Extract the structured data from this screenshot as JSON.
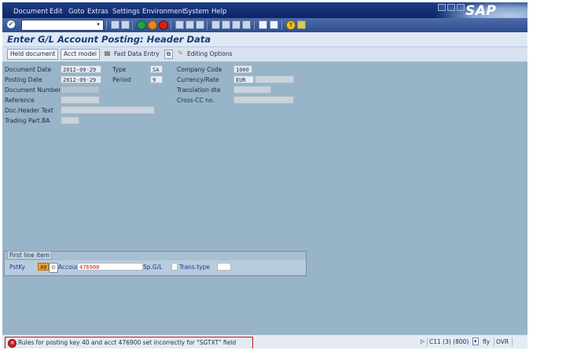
{
  "menubar": {
    "items": [
      "Document",
      "Edit",
      "Goto",
      "Extras",
      "Settings",
      "Environment",
      "System",
      "Help"
    ],
    "underline": [
      "D",
      "E",
      "G",
      "x",
      "S",
      "n",
      "y",
      "H"
    ],
    "logo": "SAP"
  },
  "systoolbar": {
    "command_value": "",
    "icons": [
      "enter-icon",
      "back-icon",
      "exit-icon",
      "cancel-icon",
      "print-icon",
      "find-icon",
      "find-next-icon",
      "first-page-icon",
      "prev-page-icon",
      "next-page-icon",
      "last-page-icon",
      "new-session-icon",
      "shortcut-icon",
      "help-icon",
      "customize-layout-icon"
    ]
  },
  "title": "Enter G/L Account Posting: Header Data",
  "apptoolbar": {
    "held_document": "Held document",
    "acct_model": "Acct model",
    "fast_data_entry": "Fast Data Entry",
    "editing_options": "Editing Options"
  },
  "header": {
    "document_date_label": "Document Date",
    "document_date": "2012-09-29",
    "type_label": "Type",
    "type": "SA",
    "company_code_label": "Company Code",
    "company_code": "1000",
    "posting_date_label": "Posting Date",
    "posting_date": "2012-09-29",
    "period_label": "Period",
    "period": "9",
    "currency_rate_label": "Currency/Rate",
    "currency": "EUR",
    "document_number_label": "Document Number",
    "translation_date_label": "Translation dte",
    "reference_label": "Reference",
    "cross_cc_label": "Cross-CC no.",
    "doc_header_text_label": "Doc.Header Text",
    "trading_part_label": "Trading Part.BA"
  },
  "first_line_item": {
    "title": "First line item",
    "pstky_label": "PstKy",
    "pstky": "40",
    "account_label": "Account",
    "account": "476900",
    "spgl_label": "Sp.G/L",
    "trans_type_label": "Trans.type"
  },
  "statusbar": {
    "message": "Rules for posting key 40 and acct 476900 set incorrectly for \"SGTXT\" field",
    "system": "C11 (3) (800)",
    "server": "fly",
    "mode": "OVR"
  },
  "colors": {
    "background": "#98b4c8",
    "menubar": "#0c2468",
    "error": "#d42020",
    "error_field": "#f0a02a"
  }
}
